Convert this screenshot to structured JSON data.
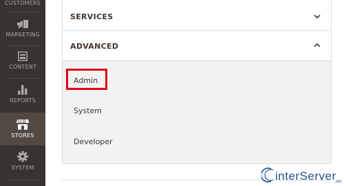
{
  "sidebar": {
    "items": [
      {
        "label": "CUSTOMERS",
        "icon": "customers-icon",
        "active": false
      },
      {
        "label": "MARKETING",
        "icon": "megaphone-icon",
        "active": false
      },
      {
        "label": "CONTENT",
        "icon": "content-layout-icon",
        "active": false
      },
      {
        "label": "REPORTS",
        "icon": "bar-chart-icon",
        "active": false
      },
      {
        "label": "STORES",
        "icon": "storefront-icon",
        "active": true
      },
      {
        "label": "SYSTEM",
        "icon": "gear-icon",
        "active": false
      }
    ]
  },
  "config": {
    "sections": [
      {
        "title": "SERVICES",
        "expanded": false,
        "chevron": "chevron-down-icon"
      },
      {
        "title": "ADVANCED",
        "expanded": true,
        "chevron": "chevron-up-icon"
      }
    ],
    "advanced_items": [
      {
        "label": "Admin",
        "highlighted": true
      },
      {
        "label": "System",
        "highlighted": false
      },
      {
        "label": "Developer",
        "highlighted": false
      }
    ]
  },
  "watermark": {
    "text": "interServer",
    "suffix": ".net"
  },
  "colors": {
    "sidebar_bg": "#373330",
    "sidebar_active_bg": "#514943",
    "highlight": "#e3000f",
    "text": "#41362f",
    "submenu_bg": "#f2f2f2",
    "watermark_blue": "#1f4f8f"
  }
}
